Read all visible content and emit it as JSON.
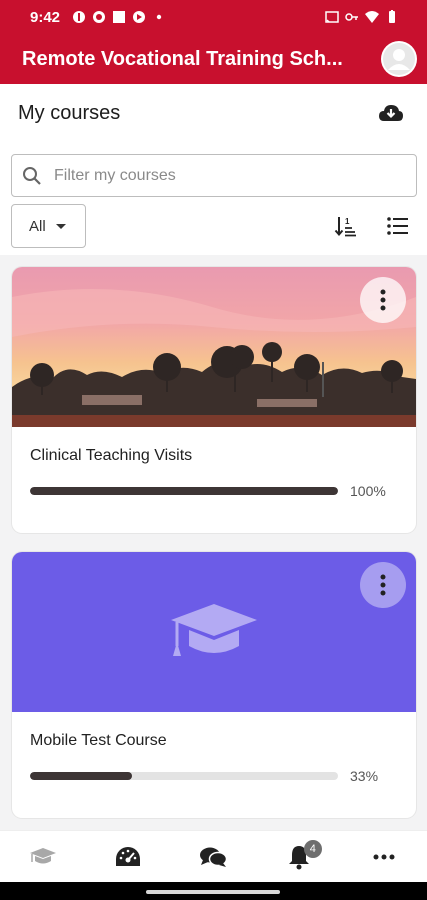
{
  "status_bar": {
    "time": "9:42"
  },
  "app_bar": {
    "title": "Remote Vocational Training Sch..."
  },
  "page": {
    "title": "My courses",
    "filter_placeholder": "Filter my courses",
    "filter_value": "",
    "status_select": "All"
  },
  "courses": [
    {
      "name": "Clinical Teaching Visits",
      "progress": 100,
      "progress_label": "100%",
      "image": "outback-sunset-photo"
    },
    {
      "name": "Mobile Test Course",
      "progress": 33,
      "progress_label": "33%",
      "image": "graduation-cap-placeholder",
      "color": "#6c5ce7"
    }
  ],
  "bottom_nav": {
    "items": [
      "courses",
      "dashboard",
      "messages",
      "notifications",
      "more"
    ],
    "notifications_badge": "4"
  },
  "colors": {
    "brand": "#c8102e",
    "progress": "#3d3535",
    "placeholder_bg": "#6c5ce7"
  }
}
